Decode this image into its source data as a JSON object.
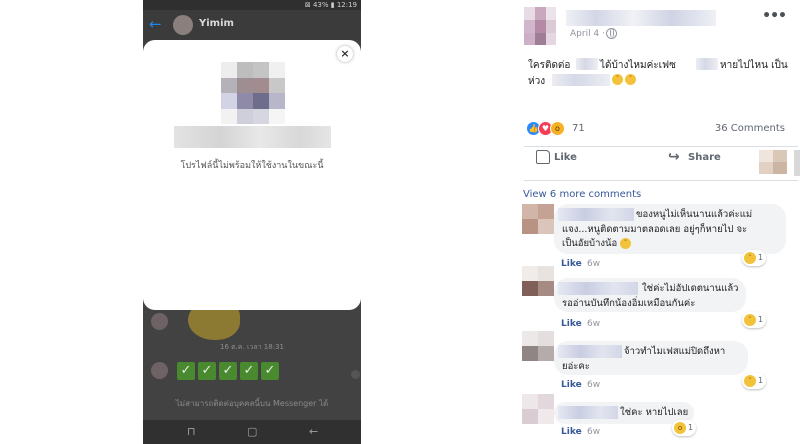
{
  "phone": {
    "status_bar": {
      "right": "⊠ 43% ▮ 12:19"
    },
    "header": {
      "back_icon": "arrow-left-icon",
      "contact_name": "Yimim"
    },
    "modal": {
      "close_label": "×",
      "message": "โปรไฟล์นี้ไม่พร้อมให้ใช้งานในขณะนี้"
    },
    "chat": {
      "date_label": "16 ต.ค. เวลา 18:31",
      "check_glyph": "✓",
      "footer_text": "ไม่สามารถติดต่อบุคคลนี้บน Messenger ได้"
    },
    "nav": {
      "recent": "⊓",
      "home": "▢",
      "back": "←"
    }
  },
  "post": {
    "date": "April 4 ·",
    "more": "•••",
    "text_line1_a": "ใครติดต่อ",
    "text_line1_b": "ได้บ้างไหมค่ะเฟซ",
    "text_line1_c": "หายไปไหน เป็น",
    "text_line2_a": "ห่วง",
    "reactions": {
      "count": "71",
      "colors": {
        "like": "#2d88ff",
        "love": "#f33e58",
        "wow": "#f7b125"
      }
    },
    "comments_count": "36 Comments",
    "like_label": "Like",
    "share_label": "Share",
    "view_more": "View 6 more comments"
  },
  "comments": [
    {
      "lines": [
        "ของหนูไม่เห็นนานแล้วค่ะแม่",
        "แจง...หนูติดตามมาตลอดเลย อยู่ๆก็หายไป จะ",
        "เป็นอัยบ้างน้อ"
      ],
      "like": "Like",
      "time": "6w",
      "react_count": "1"
    },
    {
      "lines": [
        "ใช่ค่ะไม่อัปเดตนานแล้ว",
        "รออ่านบันทึกน้องอิ่มเหมือนกันค่ะ"
      ],
      "like": "Like",
      "time": "6w",
      "react_count": "1"
    },
    {
      "lines": [
        "จ้าวทำไมเฟสแม่ปิดถึงหา",
        "ยอ่ะคะ"
      ],
      "like": "Like",
      "time": "6w",
      "react_count": "1"
    },
    {
      "lines": [
        "ใช่คะ หายไปเลย"
      ],
      "like": "Like",
      "time": "6w",
      "react_count": "1"
    }
  ]
}
